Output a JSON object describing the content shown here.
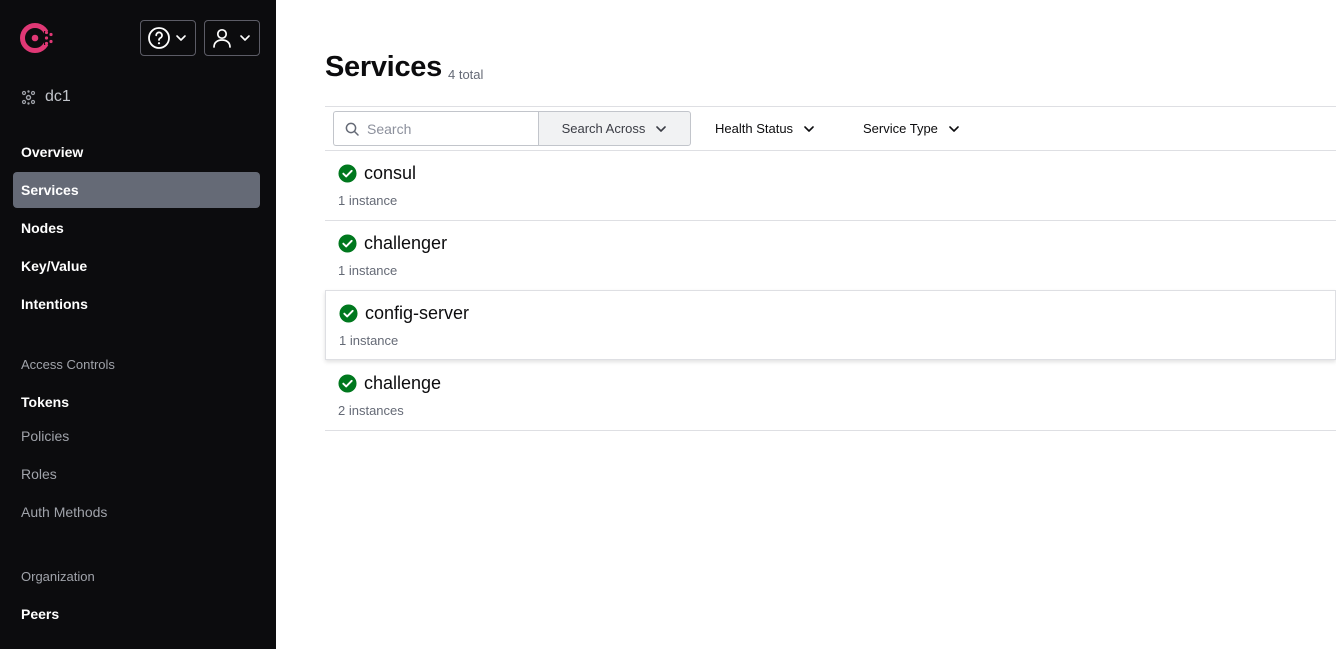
{
  "header": {
    "logo_icon": "consul-logo-icon",
    "help_icon": "question-circle-icon",
    "user_icon": "user-icon",
    "chevron_icon": "chevron-down-icon",
    "datacenter": "dc1",
    "datacenter_icon": "nodes-cluster-icon"
  },
  "nav": {
    "overview": "Overview",
    "services": "Services",
    "nodes": "Nodes",
    "kv": "Key/Value",
    "intentions": "Intentions",
    "access_heading": "Access Controls",
    "tokens": "Tokens",
    "policies": "Policies",
    "roles": "Roles",
    "auth_methods": "Auth Methods",
    "org_heading": "Organization",
    "peers": "Peers"
  },
  "page": {
    "title": "Services",
    "count": "4 total"
  },
  "filters": {
    "search_placeholder": "Search",
    "search_across": "Search Across",
    "health_status": "Health Status",
    "service_type": "Service Type"
  },
  "services": [
    {
      "name": "consul",
      "instances": "1 instance",
      "status": "passing"
    },
    {
      "name": "challenger",
      "instances": "1 instance",
      "status": "passing"
    },
    {
      "name": "config-server",
      "instances": "1 instance",
      "status": "passing"
    },
    {
      "name": "challenge",
      "instances": "2 instances",
      "status": "passing"
    }
  ],
  "colors": {
    "brand": "#e03875",
    "sidebar_bg": "#0c0c0e",
    "active_nav": "#656a76",
    "passing": "#00781e"
  }
}
